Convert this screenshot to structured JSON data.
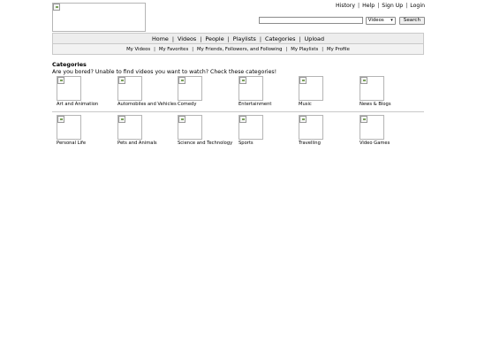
{
  "header": {
    "logo_icon": "broken-image-icon",
    "top_links": [
      "History",
      "Help",
      "Sign Up",
      "Login"
    ],
    "search": {
      "value": "",
      "placeholder": "",
      "scope": "Videos",
      "button": "Search"
    }
  },
  "nav": {
    "main": [
      "Home",
      "Videos",
      "People",
      "Playlists",
      "Categories",
      "Upload"
    ],
    "sub": [
      "My Videos",
      "My Favorites",
      "My Friends, Followers, and Following",
      "My Playlists",
      "My Profile"
    ]
  },
  "categories": {
    "heading": "Categories",
    "intro": "Are you bored? Unable to find videos you want to watch? Check these categories!",
    "rows": [
      [
        "Art and Animation",
        "Automobiles and Vehicles",
        "Comedy",
        "Entertainment",
        "Music",
        "News & Blogs"
      ],
      [
        "Personal Life",
        "Pets and Animals",
        "Science and Technology",
        "Sports",
        "Travelling",
        "Video Games"
      ]
    ]
  }
}
